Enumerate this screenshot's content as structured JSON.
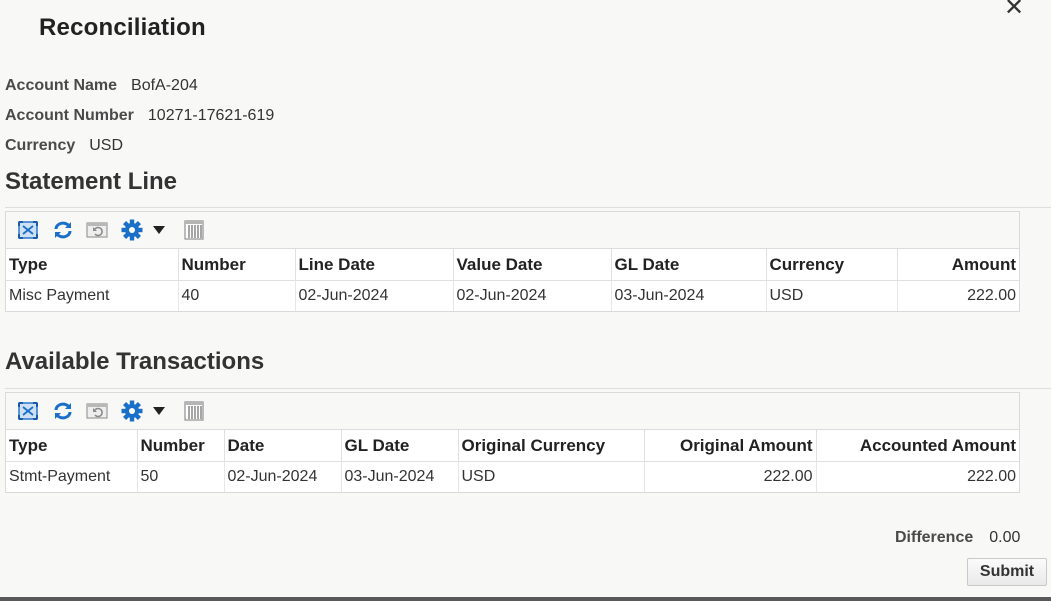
{
  "dialog": {
    "title": "Reconciliation",
    "close_glyph": "✕"
  },
  "account": {
    "name_label": "Account Name",
    "name_value": "BofA-204",
    "number_label": "Account Number",
    "number_value": "10271-17621-619",
    "currency_label": "Currency",
    "currency_value": "USD"
  },
  "statement": {
    "title": "Statement Line",
    "columns": [
      "Type",
      "Number",
      "Line Date",
      "Value Date",
      "GL Date",
      "Currency",
      "Amount"
    ],
    "rows": [
      [
        "Misc Payment",
        "40",
        "02-Jun-2024",
        "02-Jun-2024",
        "03-Jun-2024",
        "USD",
        "222.00"
      ]
    ]
  },
  "transactions": {
    "title": "Available Transactions",
    "columns": [
      "Type",
      "Number",
      "Date",
      "GL Date",
      "Original Currency",
      "Original Amount",
      "Accounted Amount"
    ],
    "rows": [
      [
        "Stmt-Payment",
        "50",
        "02-Jun-2024",
        "03-Jun-2024",
        "USD",
        "222.00",
        "222.00"
      ]
    ]
  },
  "toolbar_icons": [
    "detach-icon",
    "refresh-icon",
    "reset-icon",
    "gear-icon",
    "dropdown-arrow-icon",
    "freeze-columns-icon"
  ],
  "colors": {
    "icon_blue": "#1a6fc9",
    "background": "#f8f8f7"
  },
  "footer": {
    "difference_label": "Difference",
    "difference_value": "0.00",
    "submit_label": "Submit"
  }
}
